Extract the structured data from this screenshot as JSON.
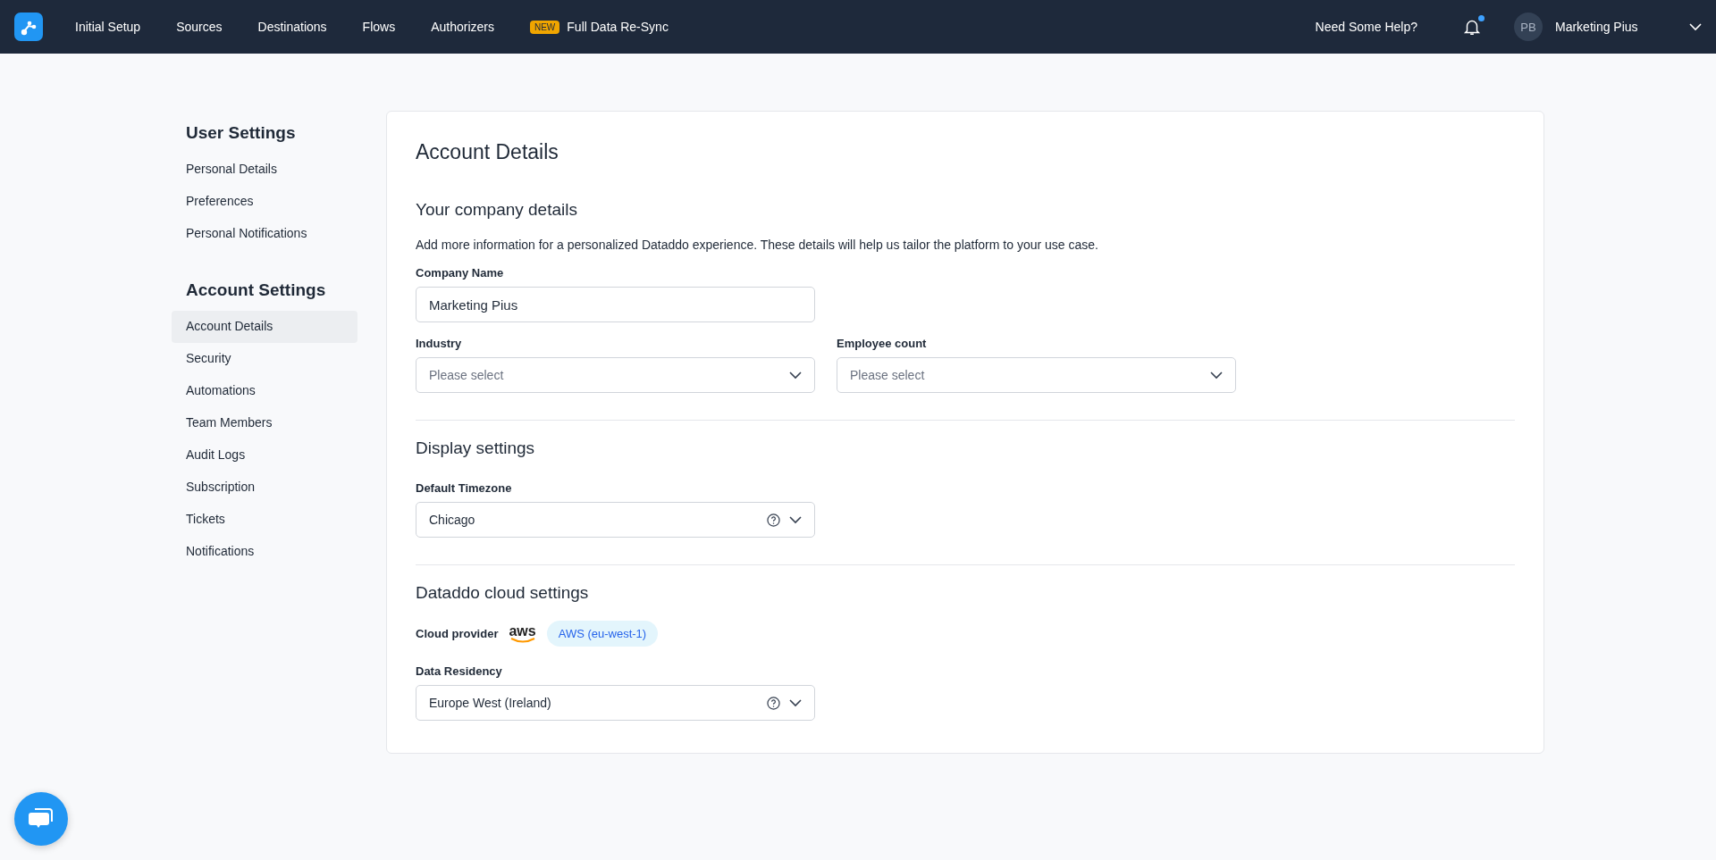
{
  "topbar": {
    "nav": [
      {
        "label": "Initial Setup"
      },
      {
        "label": "Sources"
      },
      {
        "label": "Destinations"
      },
      {
        "label": "Flows"
      },
      {
        "label": "Authorizers"
      },
      {
        "label": "Full Data Re-Sync",
        "badge": "NEW"
      }
    ],
    "help": "Need Some Help?",
    "notifications_unread": true,
    "avatar": "PB",
    "account": "Marketing Pius"
  },
  "sidebar": [
    {
      "title": "User Settings",
      "items": [
        {
          "label": "Personal Details",
          "selected": false
        },
        {
          "label": "Preferences",
          "selected": false
        },
        {
          "label": "Personal Notifications",
          "selected": false
        }
      ]
    },
    {
      "title": "Account Settings",
      "items": [
        {
          "label": "Account Details",
          "selected": true
        },
        {
          "label": "Security",
          "selected": false
        },
        {
          "label": "Automations",
          "selected": false
        },
        {
          "label": "Team Members",
          "selected": false
        },
        {
          "label": "Audit Logs",
          "selected": false
        },
        {
          "label": "Subscription",
          "selected": false
        },
        {
          "label": "Tickets",
          "selected": false
        },
        {
          "label": "Notifications",
          "selected": false
        }
      ]
    }
  ],
  "page_title": "Account Details",
  "sections": [
    {
      "title": "Your company details",
      "description": "Add more information for a personalized Dataddo experience. These details will help us tailor the platform to your use case.",
      "rows": [
        [
          {
            "kind": "input",
            "label": "Company Name",
            "value": "Marketing Pius"
          }
        ],
        [
          {
            "kind": "select",
            "label": "Industry",
            "placeholder": "Please select"
          },
          {
            "kind": "select",
            "label": "Employee count",
            "placeholder": "Please select"
          }
        ]
      ]
    },
    {
      "title": "Display settings",
      "rows": [
        [
          {
            "kind": "select",
            "label": "Default Timezone",
            "value": "Chicago",
            "help": true
          }
        ]
      ]
    },
    {
      "title": "Dataddo cloud settings",
      "cloud_provider": {
        "label": "Cloud provider",
        "logo": "aws",
        "region": "AWS (eu-west-1)"
      },
      "rows": [
        [
          {
            "kind": "select",
            "label": "Data Residency",
            "value": "Europe West (Ireland)",
            "help": true
          }
        ]
      ]
    }
  ]
}
